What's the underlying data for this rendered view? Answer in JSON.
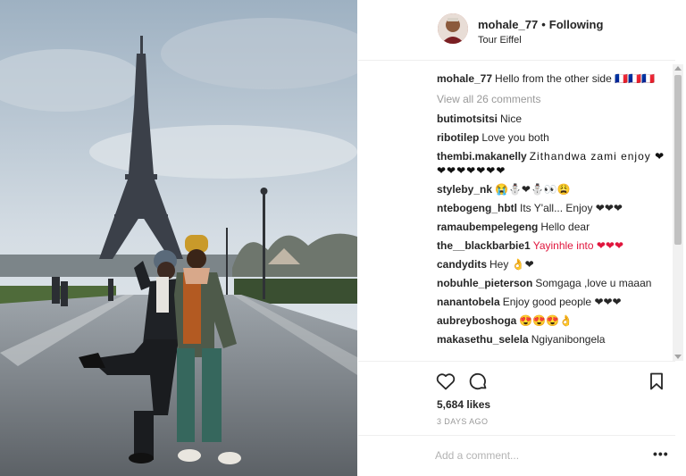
{
  "post": {
    "username": "mohale_77",
    "separator": "•",
    "follow_status": "Following",
    "location": "Tour Eiffel"
  },
  "caption": {
    "user": "mohale_77",
    "text": "Hello from the other side 🇫🇷🇫🇷🇫🇷"
  },
  "view_all": "View all 26 comments",
  "comments": [
    {
      "user": "butimotsitsi",
      "text": "Nice"
    },
    {
      "user": "ribotilep",
      "text": "Love you both"
    },
    {
      "user": "thembi.makanelly",
      "text": "Zithandwa zami enjoy ❤❤❤❤❤❤❤❤"
    },
    {
      "user": "styleby_nk",
      "text": "😭⛄❤⛄👀😩"
    },
    {
      "user": "ntebogeng_hbtl",
      "text": "Its Y'all... Enjoy ❤❤❤"
    },
    {
      "user": "ramaubempelegeng",
      "text": "Hello dear"
    },
    {
      "user": "the__blackbarbie1",
      "text": "Yayinhle into ❤❤❤"
    },
    {
      "user": "candydits",
      "text": "Hey 👌❤"
    },
    {
      "user": "nobuhle_pieterson",
      "text": "Somgaga ,love u maaan"
    },
    {
      "user": "nanantobela",
      "text": "Enjoy good people ❤❤❤"
    },
    {
      "user": "aubreyboshoga",
      "text": "😍😍😍👌"
    },
    {
      "user": "makasethu_selela",
      "text": "Ngiyanibongela"
    }
  ],
  "likes": "5,684 likes",
  "date": "3 DAYS AGO",
  "comment_input": {
    "placeholder": "Add a comment...",
    "value": ""
  },
  "more_label": "•••",
  "icons": {
    "like": "heart-icon",
    "comment": "comment-icon",
    "save": "bookmark-icon",
    "more": "ellipsis-icon"
  },
  "colors": {
    "text": "#262626",
    "muted": "#999999",
    "border": "#efefef",
    "heart_red": "#e0163d"
  }
}
